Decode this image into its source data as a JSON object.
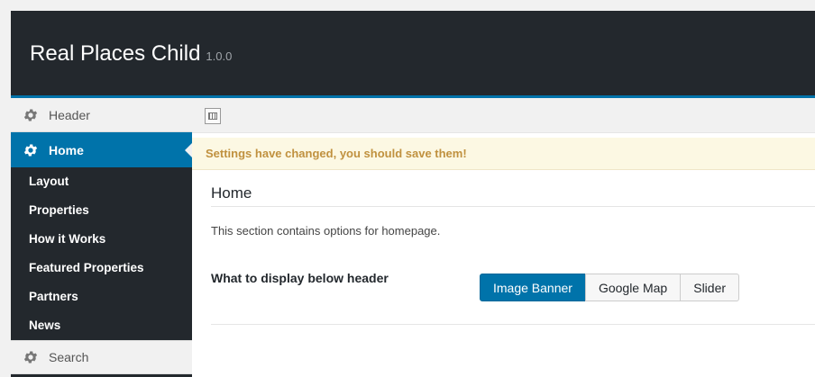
{
  "app": {
    "title": "Real Places Child",
    "version": "1.0.0"
  },
  "sidebar": {
    "sections": [
      {
        "label": "Header",
        "icon": "gear-icon"
      },
      {
        "label": "Home",
        "icon": "gear-icon",
        "active": true
      },
      {
        "label": "Search",
        "icon": "gear-icon"
      }
    ],
    "subitems": [
      "Layout",
      "Properties",
      "How it Works",
      "Featured Properties",
      "Partners",
      "News"
    ]
  },
  "notice": {
    "text": "Settings have changed, you should save them!"
  },
  "main": {
    "title": "Home",
    "description": "This section contains options for homepage.",
    "field": {
      "label": "What to display below header",
      "options": [
        "Image Banner",
        "Google Map",
        "Slider"
      ],
      "selected": "Image Banner"
    }
  },
  "colors": {
    "header_bg": "#23282d",
    "accent": "#0073aa",
    "notice_text": "#c0913f",
    "notice_bg": "#fcf8e3"
  }
}
